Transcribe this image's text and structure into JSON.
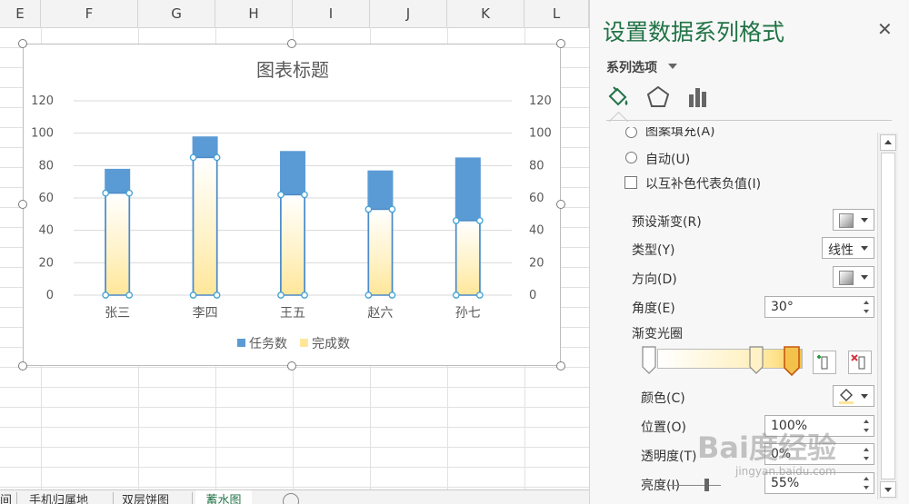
{
  "sheet": {
    "columns": [
      "E",
      "F",
      "G",
      "H",
      "I",
      "J",
      "K",
      "L"
    ],
    "tabs": [
      "间",
      "手机归属地",
      "双层饼图",
      "蓄水图"
    ],
    "active_tab": "蓄水图"
  },
  "chart_data": {
    "type": "bar",
    "title": "图表标题",
    "categories": [
      "张三",
      "李四",
      "王五",
      "赵六",
      "孙七"
    ],
    "series": [
      {
        "name": "任务数",
        "values": [
          78,
          98,
          89,
          77,
          85
        ],
        "color": "#5b9bd5"
      },
      {
        "name": "完成数",
        "values": [
          63,
          85,
          62,
          53,
          46
        ],
        "color": "#ffe699"
      }
    ],
    "yticks": [
      "0",
      "20",
      "40",
      "60",
      "80",
      "100",
      "120"
    ],
    "ylim": [
      0,
      120
    ],
    "secondary_axis": true,
    "legend_position": "bottom",
    "grid": true
  },
  "panel": {
    "title": "设置数据系列格式",
    "close_glyph": "✕",
    "options_label": "系列选项",
    "fill_icon": "paint-bucket-icon",
    "effects_icon": "pentagon-icon",
    "series_options_icon": "bar-chart-icon",
    "truncated_row": "图案填充(A)",
    "auto_label": "自动(U)",
    "invert_label": "以互补色代表负值(I)",
    "preset_label": "预设渐变(R)",
    "type_label": "类型(Y)",
    "type_value": "线性",
    "direction_label": "方向(D)",
    "angle_label": "角度(E)",
    "angle_value": "30°",
    "gradient_stops_label": "渐变光圈",
    "color_label": "颜色(C)",
    "position_label": "位置(O)",
    "position_value": "100%",
    "transparency_label": "透明度(T)",
    "transparency_value": "0%",
    "brightness_label": "亮度(I)",
    "brightness_value": "55%"
  },
  "watermark": {
    "main": "Bai度经验",
    "sub": "jingyan.baidu.com"
  }
}
